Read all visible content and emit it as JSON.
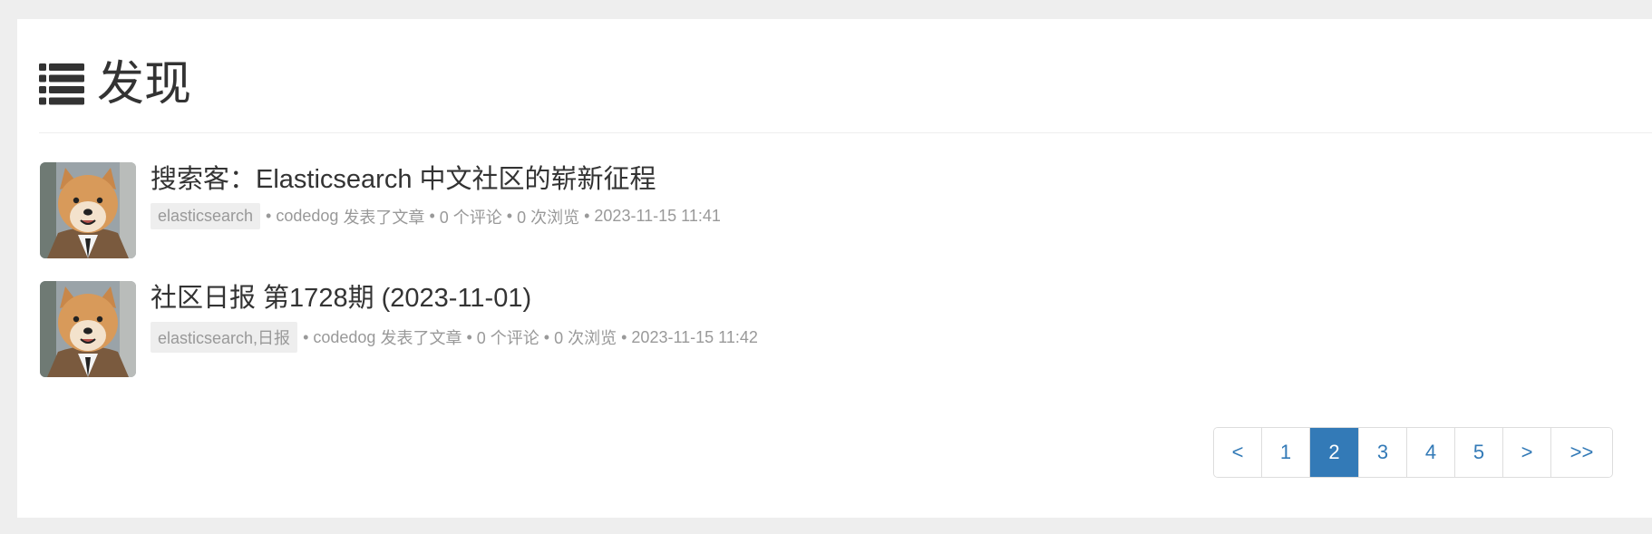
{
  "header": {
    "icon": "list-icon",
    "title": "发现"
  },
  "articles": [
    {
      "avatar_icon": "shiba-dog-avatar",
      "title": "搜索客：Elasticsearch 中文社区的崭新征程",
      "tags": "elasticsearch",
      "author": "codedog",
      "action": "发表了文章",
      "comments": "0 个评论",
      "views": "0 次浏览",
      "time": "2023-11-15 11:41"
    },
    {
      "avatar_icon": "shiba-dog-avatar",
      "title": "社区日报 第1728期 (2023-11-01)",
      "tags": "elasticsearch,日报",
      "author": "codedog",
      "action": "发表了文章",
      "comments": "0 个评论",
      "views": "0 次浏览",
      "time": "2023-11-15 11:42"
    }
  ],
  "meta_separator": "•",
  "pagination": {
    "buttons": [
      "<",
      "1",
      "2",
      "3",
      "4",
      "5",
      ">",
      ">>"
    ],
    "active": "2",
    "active_color": "#337ab7",
    "link_color": "#337ab7"
  }
}
